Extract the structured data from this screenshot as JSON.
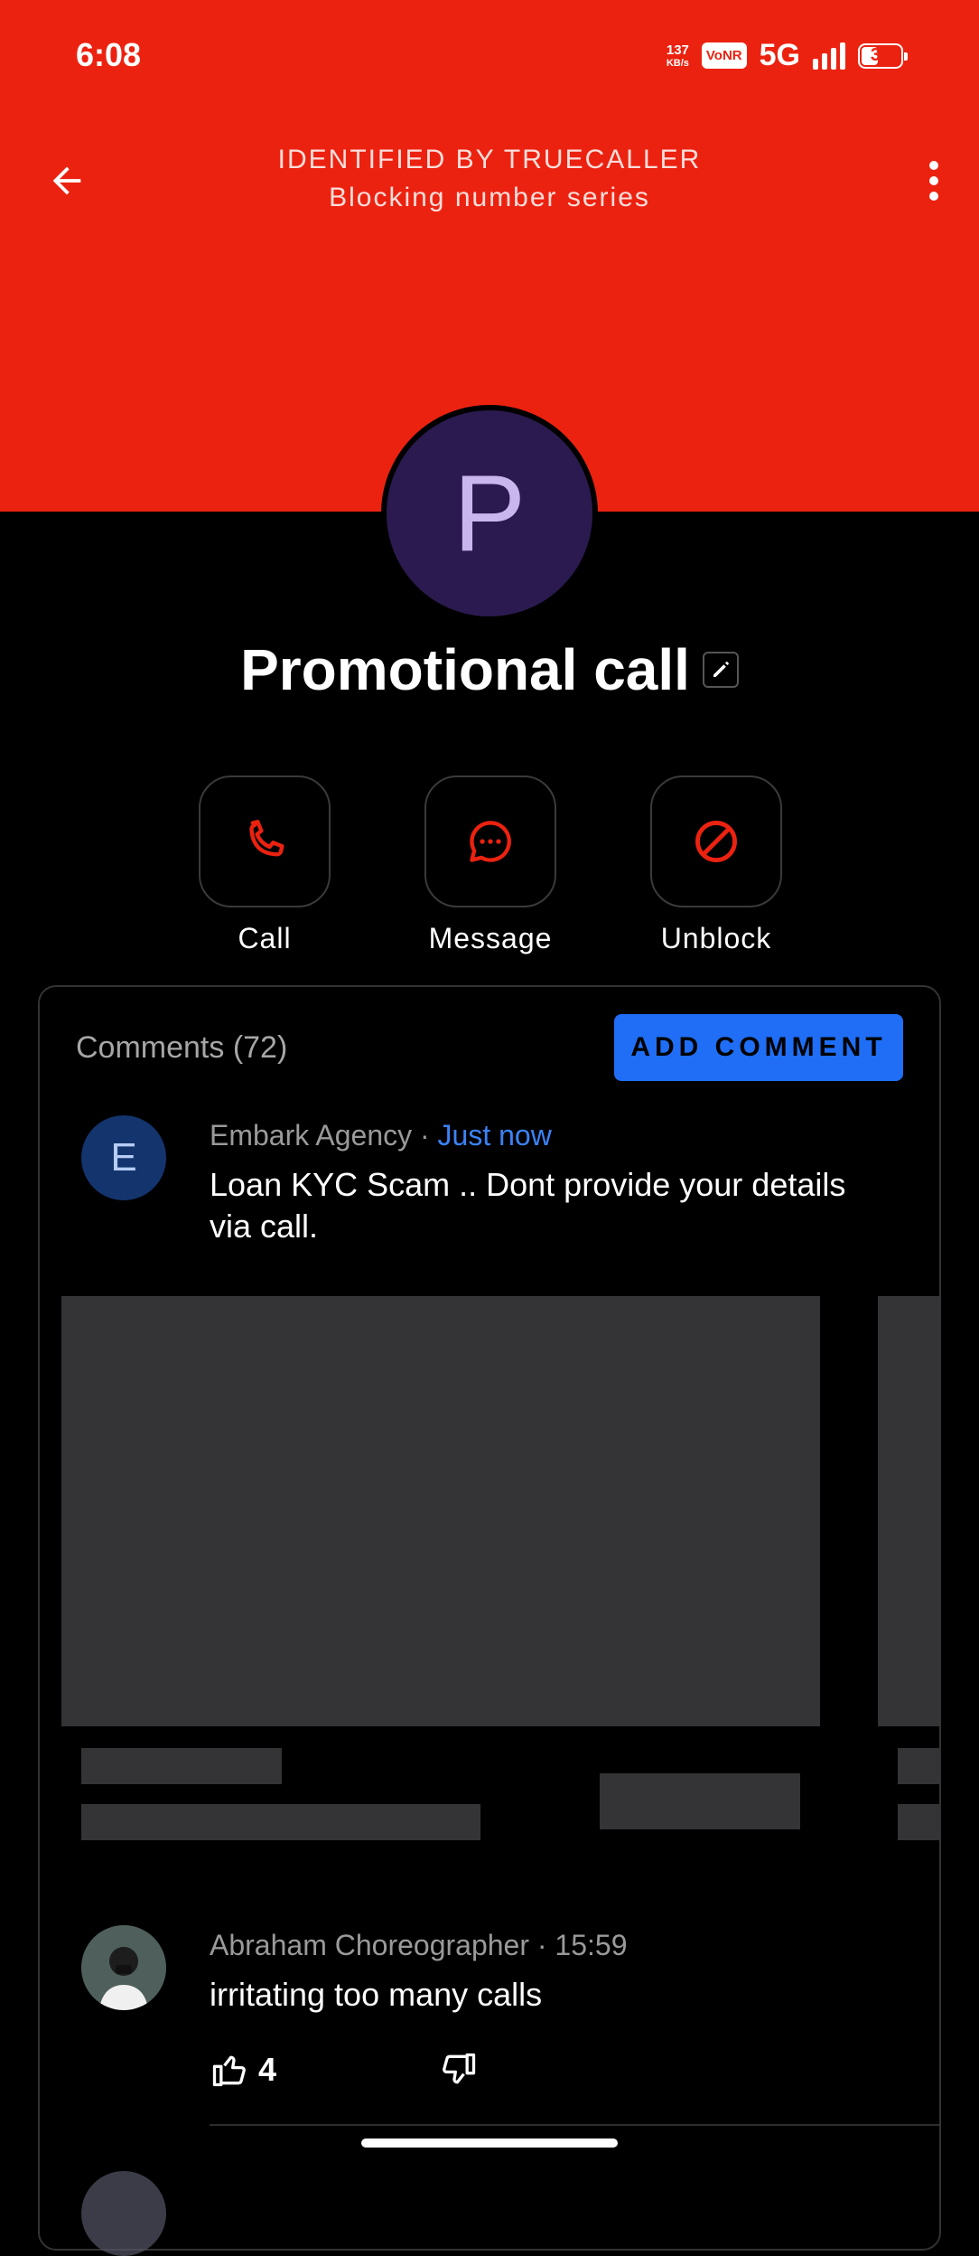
{
  "status_bar": {
    "time": "6:08",
    "speed_value": "137",
    "speed_unit": "KB/s",
    "vonr": "VoNR",
    "network": "5G",
    "battery": "39"
  },
  "header": {
    "title": "IDENTIFIED BY TRUECALLER",
    "subtitle": "Blocking number series",
    "icons": {
      "back": "arrow-left-icon",
      "more": "more-vert-icon"
    },
    "color": "#ec2210"
  },
  "contact": {
    "avatar_letter": "P",
    "name": "Promotional call"
  },
  "actions": [
    {
      "label": "Call",
      "icon": "phone-icon"
    },
    {
      "label": "Message",
      "icon": "message-icon"
    },
    {
      "label": "Unblock",
      "icon": "block-icon"
    }
  ],
  "comments": {
    "title": "Comments (72)",
    "add_button": "ADD COMMENT",
    "items": [
      {
        "avatar_letter": "E",
        "author": "Embark Agency",
        "separator": "·",
        "time": "Just now",
        "text": "Loan KYC Scam .. Dont provide your details via call."
      },
      {
        "author": "Abraham Choreographer",
        "separator": "·",
        "time": "15:59",
        "text": "irritating too many calls",
        "likes": "4"
      }
    ]
  },
  "colors": {
    "accent": "#ec2210",
    "button_blue": "#1f6ef5",
    "avatar_bg": "#2b1a4f"
  }
}
